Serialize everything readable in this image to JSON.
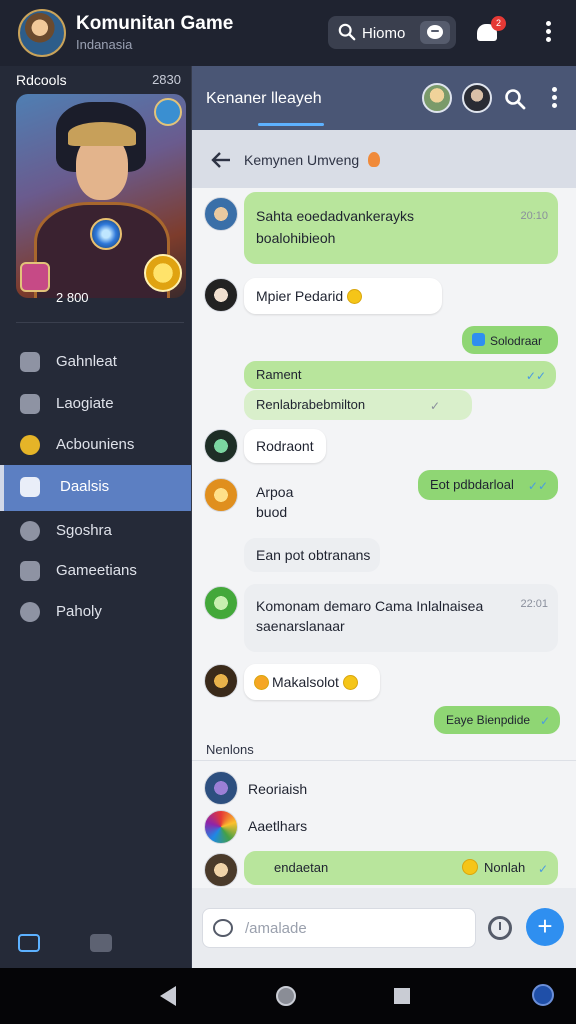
{
  "app": {
    "title": "Komunitan Game",
    "subtitle": "Indanasia",
    "search_label": "Hiomo",
    "notification_count": "2"
  },
  "sidebar": {
    "header_left": "Rdcools",
    "header_right": "2830",
    "hero_score": "2 800",
    "items": [
      {
        "label": "Gahnleat",
        "icon": "star-icon"
      },
      {
        "label": "Laogiate",
        "icon": "chart-icon"
      },
      {
        "label": "Acbouniens",
        "icon": "badge-icon"
      },
      {
        "label": "Daalsis",
        "icon": "home-icon",
        "active": true
      },
      {
        "label": "Sgoshra",
        "icon": "group-icon"
      },
      {
        "label": "Gameetians",
        "icon": "gamepad-icon"
      },
      {
        "label": "Paholy",
        "icon": "chat-icon"
      }
    ],
    "bottom_icons": [
      "edit-icon",
      "tag-icon"
    ]
  },
  "chat": {
    "header_title": "Kenaner lleayeh",
    "sub_title": "Kemynen Umveng",
    "messages": [
      {
        "dir": "out-top",
        "text_line1": "Sahta eoedadvankerayks",
        "text_line2": "boalohibieoh",
        "time": "20:10"
      },
      {
        "dir": "in",
        "text": "Mpier Pedarid"
      },
      {
        "dir": "out",
        "text": "Solodraar"
      },
      {
        "dir": "out",
        "text": "Rament"
      },
      {
        "dir": "out",
        "text": "Renlabrabebmilton"
      },
      {
        "dir": "in",
        "text": "Rodraont"
      },
      {
        "dir": "in",
        "text_line1": "Arpoa",
        "text_line2": "buod"
      },
      {
        "dir": "out",
        "text": "Eot pdbdarloal"
      },
      {
        "dir": "in",
        "text": "Ean pot obtranans"
      },
      {
        "dir": "in",
        "text_line1": "Komonam demaro Cama Inlalnaisea",
        "text_line2": "saenarslanaar",
        "time": "22:01"
      },
      {
        "dir": "in",
        "text": "Makalsolot"
      },
      {
        "dir": "out",
        "text": "Eaye Bienpdide"
      }
    ],
    "section_label": "Nenlons",
    "mentions": [
      {
        "name": "Reoriaish"
      },
      {
        "name": "Aaetlhars"
      }
    ],
    "last_message": {
      "text": "endaetan",
      "right_text": "Nonlah"
    },
    "input_placeholder": "/amalade"
  },
  "colors": {
    "accent": "#2f8ff0",
    "active_nav": "#5c7fc2",
    "out_bubble": "#b8e59c",
    "header": "#4a5675"
  }
}
